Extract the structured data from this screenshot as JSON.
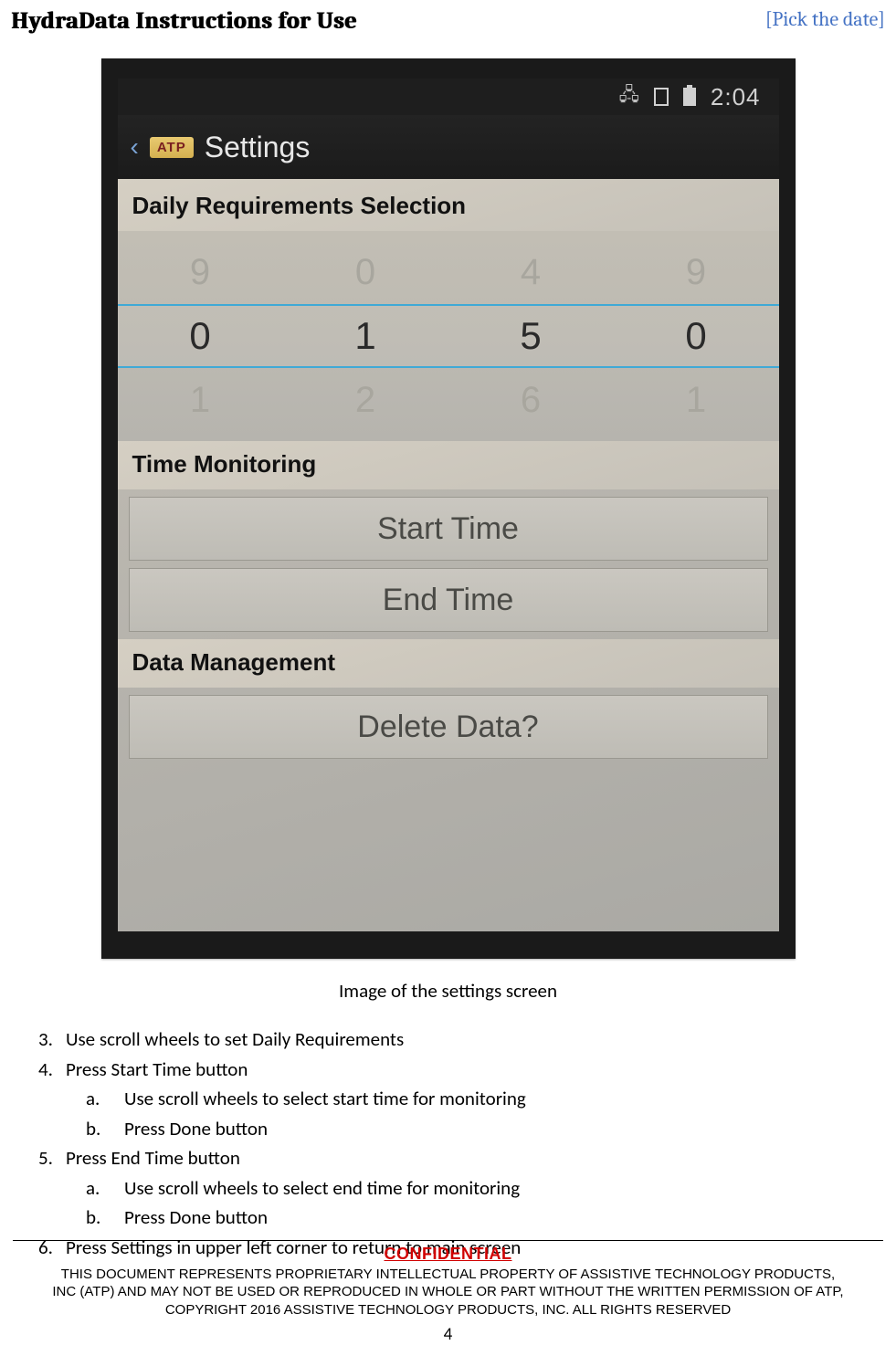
{
  "header": {
    "title": "HydraData Instructions for Use",
    "date_placeholder": "[Pick the date]"
  },
  "screenshot": {
    "status_bar": {
      "time": "2:04"
    },
    "app_bar": {
      "brand": "ATP",
      "title": "Settings"
    },
    "sections": {
      "daily_req_label": "Daily Requirements Selection",
      "picker_rows": {
        "above": [
          "9",
          "0",
          "4",
          "9"
        ],
        "selected": [
          "0",
          "1",
          "5",
          "0"
        ],
        "below": [
          "1",
          "2",
          "6",
          "1"
        ]
      },
      "time_monitoring_label": "Time Monitoring",
      "start_time_btn": "Start Time",
      "end_time_btn": "End Time",
      "data_mgmt_label": "Data Management",
      "delete_btn": "Delete Data?"
    }
  },
  "caption": "Image of the settings screen",
  "instructions": {
    "i3": "Use scroll wheels to set Daily Requirements",
    "i4": "Press Start Time button",
    "i4a": "Use scroll wheels to select start time for monitoring",
    "i4b": "Press Done button",
    "i5": "Press End Time button",
    "i5a": "Use scroll wheels to select end time for monitoring",
    "i5b": "Press Done button",
    "i6": "Press Settings in upper left corner to return to main screen"
  },
  "footer": {
    "confidential": "CONFIDENTIAL",
    "line1": "THIS DOCUMENT REPRESENTS PROPRIETARY INTELLECTUAL PROPERTY OF ASSISTIVE TECHNOLOGY PRODUCTS,",
    "line2": "INC (ATP) AND MAY NOT BE USED OR REPRODUCED IN WHOLE OR PART WITHOUT THE WRITTEN PERMISSION OF ATP,",
    "line3": "COPYRIGHT 2016 ASSISTIVE TECHNOLOGY PRODUCTS, INC. ALL RIGHTS RESERVED",
    "page": "4"
  }
}
